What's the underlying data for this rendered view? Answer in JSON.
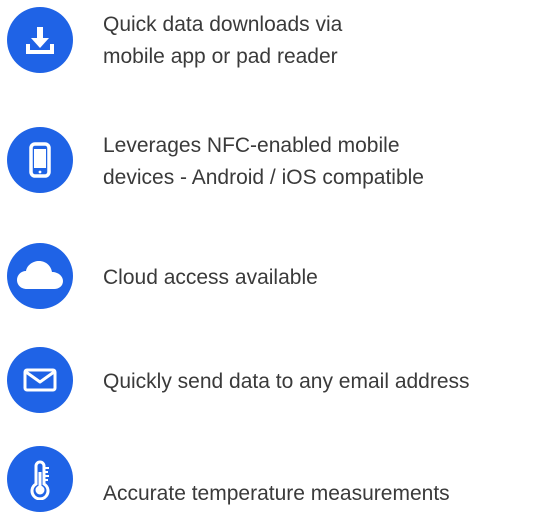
{
  "theme": {
    "accent": "#1f63e6",
    "text": "#3a3a3a",
    "background": "#ffffff"
  },
  "features": [
    {
      "icon": "download-icon",
      "lines": [
        "Quick data downloads via",
        "mobile app or pad reader"
      ]
    },
    {
      "icon": "smartphone-icon",
      "lines": [
        "Leverages NFC-enabled mobile",
        "devices - Android / iOS compatible"
      ]
    },
    {
      "icon": "cloud-icon",
      "lines": [
        "Cloud access available"
      ]
    },
    {
      "icon": "envelope-icon",
      "lines": [
        "Quickly send data to any email address"
      ]
    },
    {
      "icon": "thermometer-icon",
      "lines": [
        "Accurate temperature measurements"
      ]
    }
  ]
}
